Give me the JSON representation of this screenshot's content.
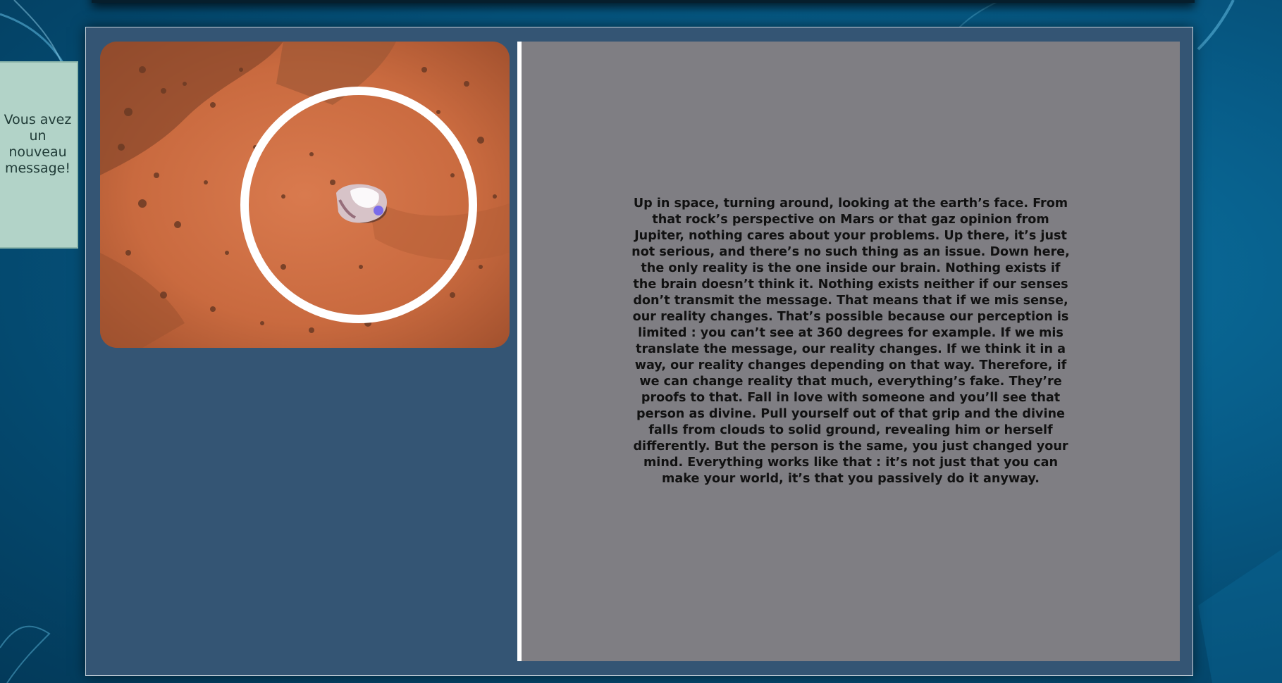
{
  "notification": {
    "text": "Vous avez un nouveau message!"
  },
  "photo": {
    "subject": "rock on Mars surface with white circle highlight"
  },
  "article": {
    "text": "Up in space, turning around, looking at the earth’s face. From that rock’s perspective on Mars or that gaz opinion from Jupiter, nothing cares about your problems. Up there, it’s just not serious, and there’s no such thing as an issue. Down here, the only reality is the one inside our brain. Nothing exists if the brain doesn’t think it. Nothing exists neither if our senses don’t transmit the message. That means that if we mis sense, our reality changes. That’s possible because our perception is limited : you can’t see at 360 degrees for example. If we mis translate the message, our reality changes. If we think it in a way, our reality changes depending on that way. Therefore, if we can change reality that much, everything’s fake. They’re proofs to that. Fall in love with someone and you’ll see that person as divine. Pull yourself out of that grip and the divine falls from clouds to solid ground, revealing him or herself differently. But the person is the same, you just changed your mind. Everything works like that : it’s not just that you can make your world, it’s that you passively do it anyway."
  },
  "colors": {
    "background": "#075c88",
    "frame": "#345574",
    "text_panel": "#7f7e83",
    "notification": "#b2d3c8"
  }
}
